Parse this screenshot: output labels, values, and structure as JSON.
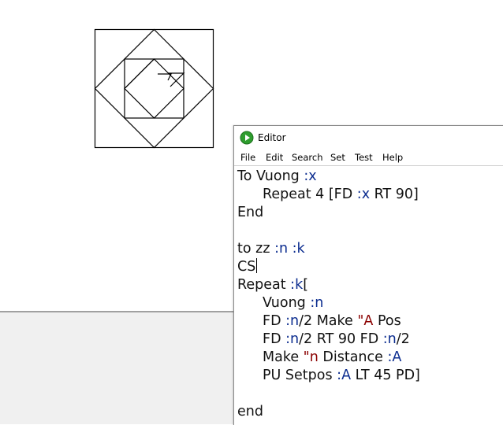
{
  "editor": {
    "title": "Editor",
    "icon": "play-icon",
    "accent": "#2e9d2e",
    "menu": [
      "File",
      "Edit",
      "Search",
      "Set",
      "Test",
      "Help"
    ]
  },
  "code": {
    "l1": {
      "a": "To Vuong ",
      "b": ":x"
    },
    "l2": {
      "a": "Repeat 4 [FD ",
      "b": ":x",
      "c": " RT 90]"
    },
    "l3": {
      "a": "End"
    },
    "l5": {
      "a": "to zz ",
      "b": ":n",
      "c": " ",
      "d": ":k"
    },
    "l6": {
      "a": "CS"
    },
    "l7": {
      "a": "Repeat ",
      "b": ":k",
      "c": "["
    },
    "l8": {
      "a": "Vuong ",
      "b": ":n"
    },
    "l9": {
      "a": "FD ",
      "b": ":n",
      "c": "/2 Make ",
      "d": "\"A",
      "e": " Pos"
    },
    "l10": {
      "a": "FD ",
      "b": ":n",
      "c": "/2 RT 90 FD ",
      "d": ":n",
      "e": "/2"
    },
    "l11": {
      "a": "Make ",
      "b": "\"n",
      "c": " Distance ",
      "d": ":A"
    },
    "l12": {
      "a": "PU Setpos ",
      "b": ":A",
      "c": " LT 45 PD]"
    },
    "l14": {
      "a": "end"
    }
  },
  "colors": {
    "variable": "#0b2c8f",
    "quoted_word": "#8b0000",
    "panel_background": "#f0f0f0"
  }
}
